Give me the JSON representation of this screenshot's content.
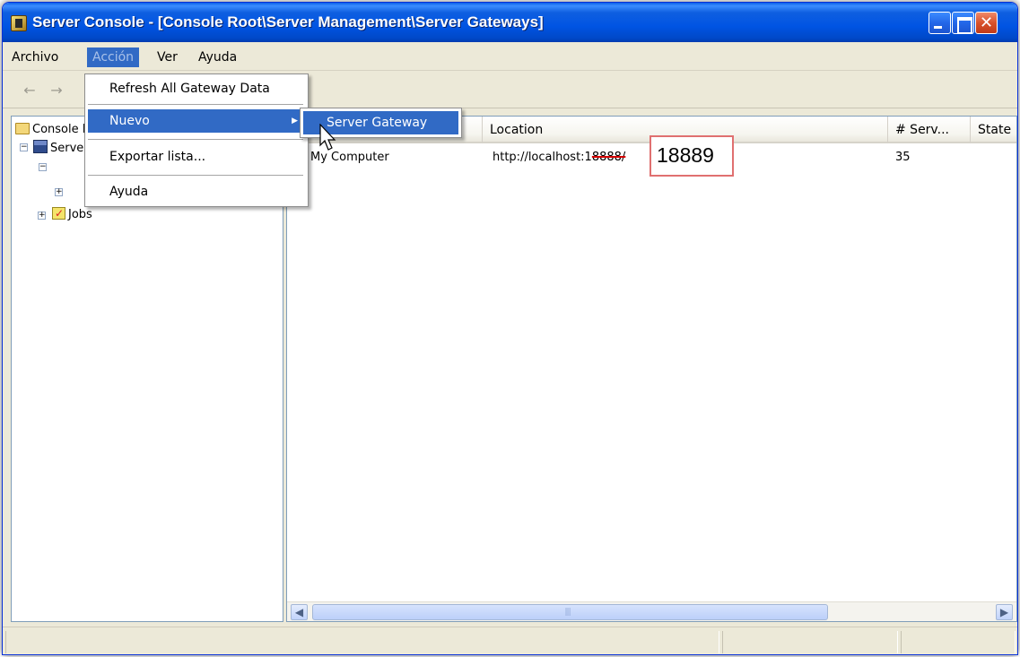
{
  "window": {
    "title": "Server Console - [Console Root\\Server Management\\Server Gateways]",
    "close_glyph": "✕"
  },
  "menubar": {
    "items": [
      "Archivo",
      "Acción",
      "Ver",
      "Ayuda"
    ]
  },
  "context_menu": {
    "refresh": "Refresh All Gateway Data",
    "nuevo": "Nuevo",
    "exportar": "Exportar lista...",
    "ayuda": "Ayuda"
  },
  "submenu": {
    "server_gateway": "Server Gateway"
  },
  "tree": {
    "console_root": "Console Root",
    "server_management": "Server Management",
    "jobs": "Jobs"
  },
  "list": {
    "columns": [
      "Location",
      "# Serv...",
      "State"
    ],
    "row": {
      "name": "My Computer",
      "location_prefix": "http://localhost:1",
      "location_struck": "8888/",
      "servers": "35"
    }
  },
  "annotation": {
    "value": "18889"
  },
  "colors": {
    "selection": "#316ac5",
    "title_bar": "#0054e3",
    "annotation_border": "#e07070",
    "strike": "#d40000"
  }
}
